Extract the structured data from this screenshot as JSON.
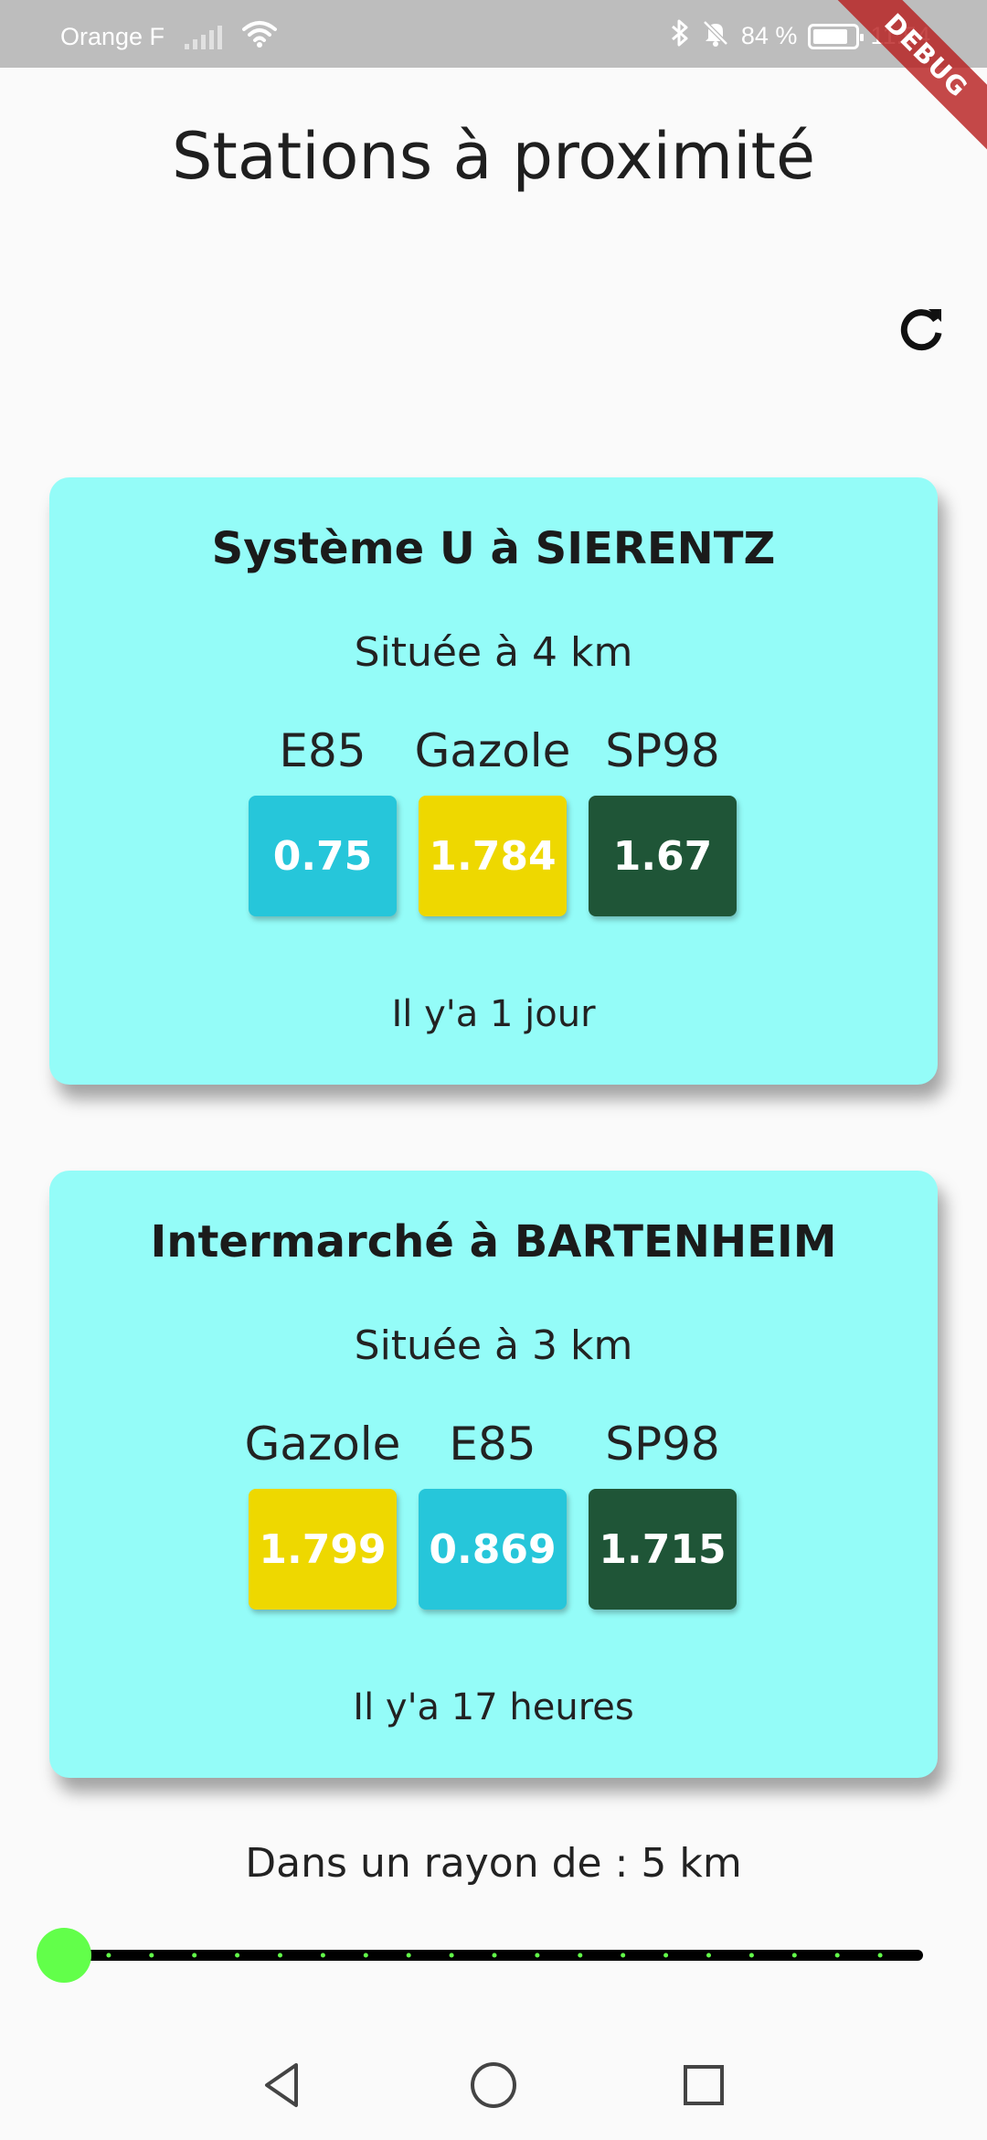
{
  "status_bar": {
    "carrier": "Orange F",
    "battery_percent": "84 %",
    "time": "11:54",
    "battery_level": 0.84,
    "icons": [
      "signal-icon",
      "wifi-icon",
      "bluetooth-icon",
      "bell-off-icon",
      "battery-icon"
    ]
  },
  "debug_banner": "DEBUG",
  "header": {
    "title": "Stations à proximité"
  },
  "refresh": {
    "icon": "refresh-icon"
  },
  "stations": [
    {
      "name": "Système U à SIERENTZ",
      "distance": "Située à 4 km",
      "fuels": [
        {
          "name": "E85",
          "price": "0.75",
          "color": "#26c6da"
        },
        {
          "name": "Gazole",
          "price": "1.784",
          "color": "#eed800"
        },
        {
          "name": "SP98",
          "price": "1.67",
          "color": "#1f5537"
        }
      ],
      "updated": "Il y'a 1 jour"
    },
    {
      "name": "Intermarché à BARTENHEIM",
      "distance": "Située à 3 km",
      "fuels": [
        {
          "name": "Gazole",
          "price": "1.799",
          "color": "#eed800"
        },
        {
          "name": "E85",
          "price": "0.869",
          "color": "#26c6da"
        },
        {
          "name": "SP98",
          "price": "1.715",
          "color": "#1f5537"
        }
      ],
      "updated": "Il y'a 17 heures"
    }
  ],
  "radius": {
    "label": "Dans un rayon de : 5 km",
    "value_fraction": 0.0
  },
  "nav": {
    "icons": [
      "back-icon",
      "home-icon",
      "recents-icon"
    ]
  },
  "colors": {
    "card_background": "#94fcf8",
    "slider_thumb": "#62ff4a",
    "slider_track": "#000000"
  }
}
